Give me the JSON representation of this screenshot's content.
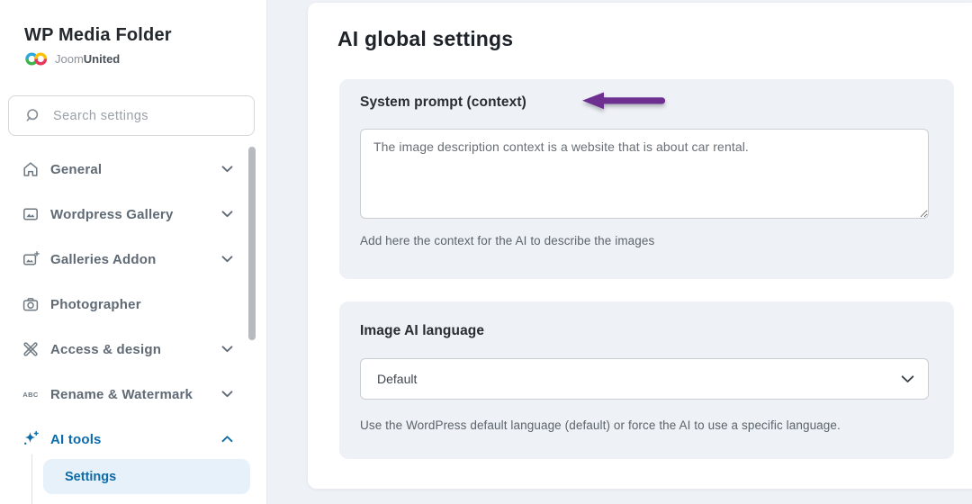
{
  "app": {
    "title": "WP Media Folder",
    "brand_joom": "Joom",
    "brand_united": "United"
  },
  "sidebar": {
    "search_placeholder": "Search settings",
    "items": [
      {
        "label": "General",
        "icon": "home-icon",
        "chevron": "down"
      },
      {
        "label": "Wordpress Gallery",
        "icon": "gallery-icon",
        "chevron": "down"
      },
      {
        "label": "Galleries Addon",
        "icon": "gallery-add-icon",
        "chevron": "down"
      },
      {
        "label": "Photographer",
        "icon": "camera-icon",
        "chevron": "none"
      },
      {
        "label": "Access & design",
        "icon": "design-tools-icon",
        "chevron": "down"
      },
      {
        "label": "Rename & Watermark",
        "icon": "abc-icon",
        "chevron": "down"
      },
      {
        "label": "AI tools",
        "icon": "ai-sparkle-icon",
        "chevron": "up",
        "active": true
      }
    ],
    "subitem": {
      "label": "Settings",
      "active": true
    }
  },
  "main": {
    "title": "AI global settings",
    "system_prompt": {
      "heading": "System prompt (context)",
      "value": "The image description context is a website that is about car rental.",
      "help": "Add here the context for the AI to describe the images"
    },
    "language": {
      "heading": "Image AI language",
      "value": "Default",
      "help": "Use the WordPress default language (default) or force the AI to use a specific language."
    },
    "annotation": {
      "type": "arrow-left",
      "color": "#6d2f90"
    }
  },
  "colors": {
    "accent_blue": "#0c6ba8",
    "active_item_bg": "#e7f1f9",
    "section_bg": "#eef1f5",
    "page_bg": "#eef1f6",
    "arrow_purple": "#6d2f90"
  }
}
